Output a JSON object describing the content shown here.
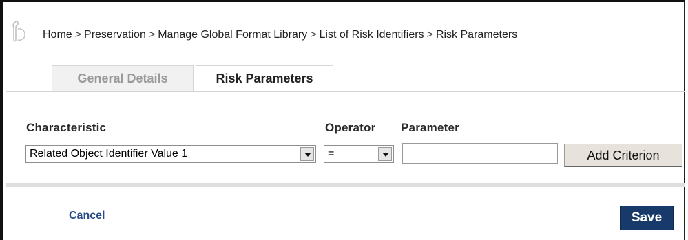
{
  "breadcrumb": {
    "items": [
      "Home",
      "Preservation",
      "Manage Global Format Library",
      "List of Risk Identifiers",
      "Risk Parameters"
    ],
    "separator": ">"
  },
  "tabs": [
    {
      "label": "General Details",
      "active": false
    },
    {
      "label": "Risk Parameters",
      "active": true
    }
  ],
  "form": {
    "characteristic_label": "Characteristic",
    "operator_label": "Operator",
    "parameter_label": "Parameter",
    "characteristic_value": "Related Object Identifier Value 1",
    "operator_value": "=",
    "parameter_value": "",
    "add_criterion_label": "Add Criterion"
  },
  "footer": {
    "cancel_label": "Cancel",
    "save_label": "Save"
  },
  "colors": {
    "save_button": "#173a6b",
    "cancel_link": "#2a4b86",
    "inactive_tab_text": "#9a9a9a"
  },
  "icons": {
    "home": "home-icon",
    "dropdown": "chevron-down-icon"
  }
}
